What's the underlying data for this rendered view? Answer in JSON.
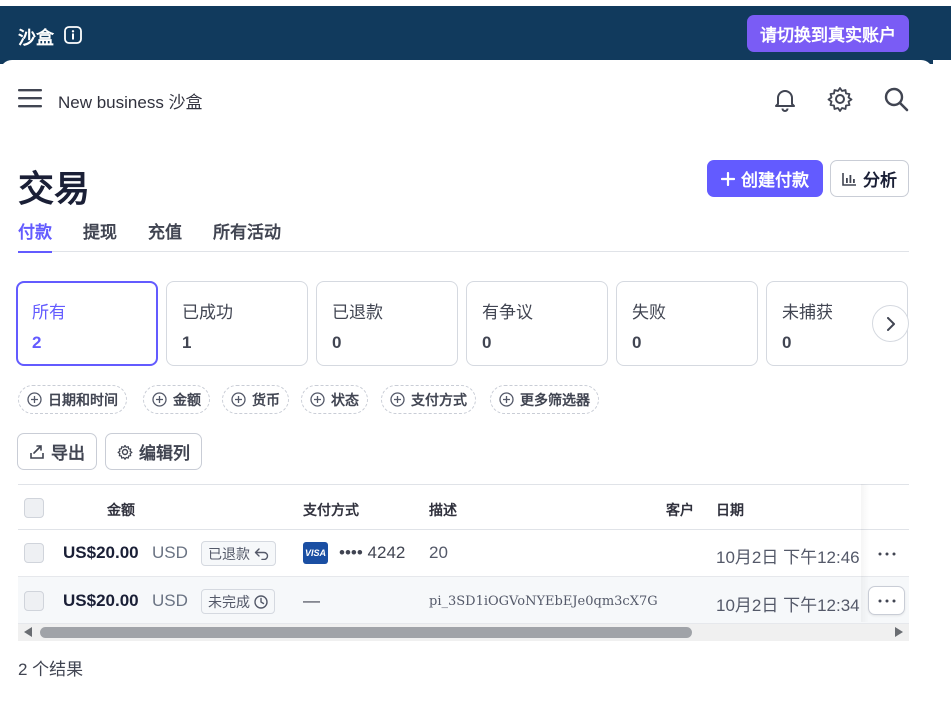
{
  "topbar": {
    "sandbox_label": "沙盒",
    "switch_button": "请切换到真实账户",
    "colors": {
      "background": "#113a5d",
      "switch_button": "#7a5cf5"
    }
  },
  "header": {
    "title": "New business 沙盒",
    "icons": [
      "menu-icon",
      "bell-icon",
      "gear-icon",
      "search-icon"
    ]
  },
  "page": {
    "title": "交易",
    "create_button": "创建付款",
    "analyze_button": "分析",
    "accent_color": "#635bff"
  },
  "tabs": [
    {
      "label": "付款",
      "active": true
    },
    {
      "label": "提现",
      "active": false
    },
    {
      "label": "充值",
      "active": false
    },
    {
      "label": "所有活动",
      "active": false
    }
  ],
  "status_cards": [
    {
      "label": "所有",
      "count": "2",
      "active": true
    },
    {
      "label": "已成功",
      "count": "1",
      "active": false
    },
    {
      "label": "已退款",
      "count": "0",
      "active": false
    },
    {
      "label": "有争议",
      "count": "0",
      "active": false
    },
    {
      "label": "失败",
      "count": "0",
      "active": false
    },
    {
      "label": "未捕获",
      "count": "0",
      "active": false
    }
  ],
  "filters": [
    "日期和时间",
    "金额",
    "货币",
    "状态",
    "支付方式",
    "更多筛选器"
  ],
  "actions": {
    "export": "导出",
    "edit_columns": "编辑列"
  },
  "table": {
    "columns": [
      "金额",
      "支付方式",
      "描述",
      "客户",
      "日期"
    ],
    "rows": [
      {
        "amount": "US$20.00",
        "currency": "USD",
        "status": "已退款",
        "status_icon": "refund-arrow-icon",
        "card_brand": "VISA",
        "payment_method": "•••• 4242",
        "description": "20",
        "customer": "",
        "date": "10月2日 下午12:46"
      },
      {
        "amount": "US$20.00",
        "currency": "USD",
        "status": "未完成",
        "status_icon": "clock-icon",
        "payment_method": "—",
        "description": "pi_3SD1iOGVoNYEbEJe0qm3cX7G",
        "customer": "",
        "date": "10月2日 下午12:34"
      }
    ]
  },
  "results": "2 个结果"
}
